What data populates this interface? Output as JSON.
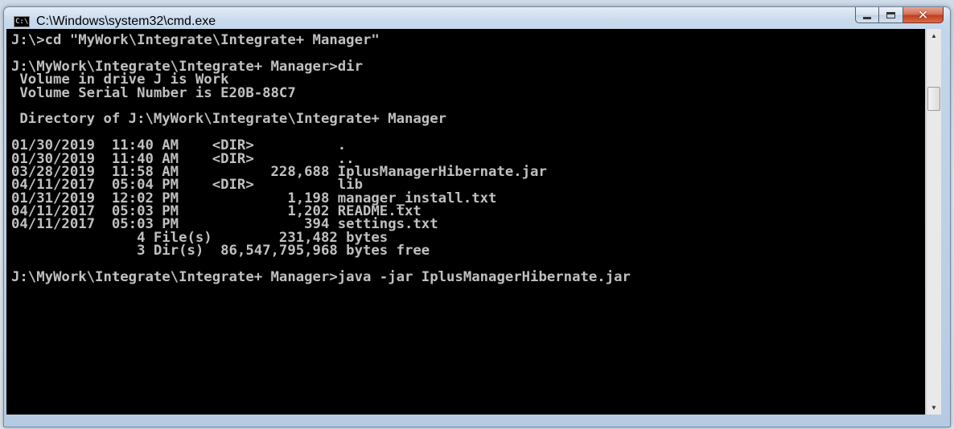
{
  "window": {
    "title": "C:\\Windows\\system32\\cmd.exe",
    "icon_label": "C:\\",
    "icons": {
      "minimize": "minimize-icon",
      "maximize": "maximize-icon",
      "close": "close-icon"
    }
  },
  "console": {
    "lines": [
      "J:\\>cd \"MyWork\\Integrate\\Integrate+ Manager\"",
      "",
      "J:\\MyWork\\Integrate\\Integrate+ Manager>dir",
      " Volume in drive J is Work",
      " Volume Serial Number is E20B-88C7",
      "",
      " Directory of J:\\MyWork\\Integrate\\Integrate+ Manager",
      "",
      "01/30/2019  11:40 AM    <DIR>          .",
      "01/30/2019  11:40 AM    <DIR>          ..",
      "03/28/2019  11:58 AM           228,688 IplusManagerHibernate.jar",
      "04/11/2017  05:04 PM    <DIR>          lib",
      "01/31/2019  12:02 PM             1,198 manager_install.txt",
      "04/11/2017  05:03 PM             1,202 README.txt",
      "04/11/2017  05:03 PM               394 settings.txt",
      "               4 File(s)        231,482 bytes",
      "               3 Dir(s)  86,547,795,968 bytes free",
      "",
      "J:\\MyWork\\Integrate\\Integrate+ Manager>java -jar IplusManagerHibernate.jar"
    ]
  },
  "colors": {
    "console_bg": "#000000",
    "console_text": "#c0c0c0",
    "close_button": "#c13f1f"
  }
}
